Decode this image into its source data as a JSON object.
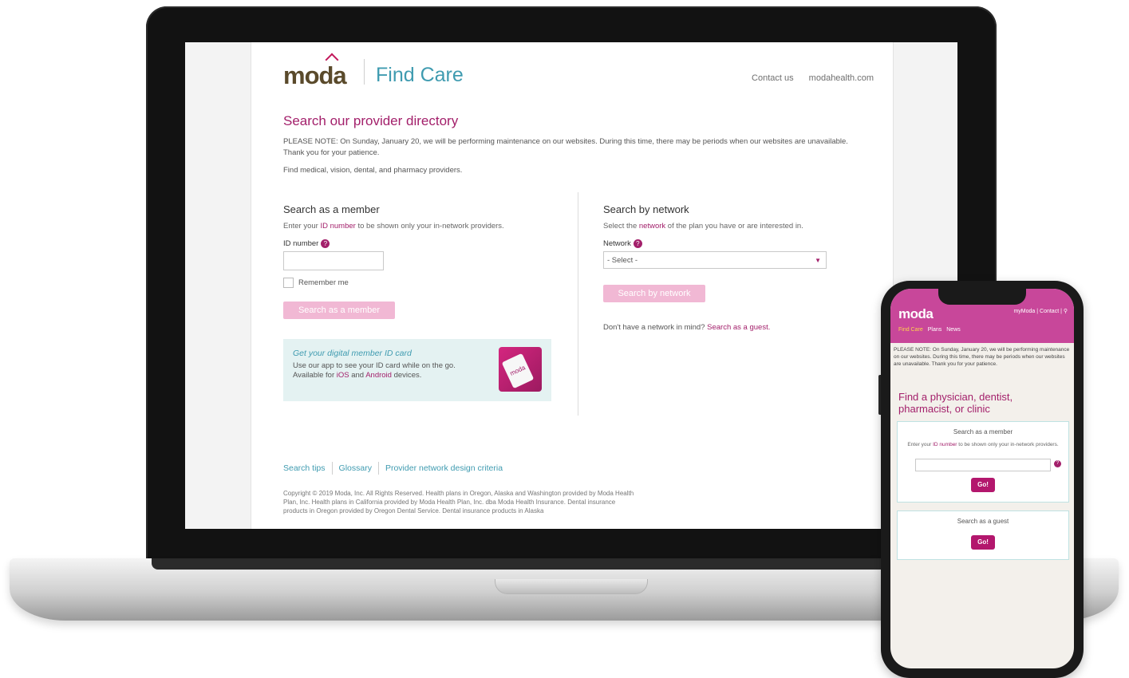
{
  "laptop": {
    "header": {
      "logo_text": "moda",
      "product_name": "Find Care",
      "contact_link": "Contact us",
      "site_link": "modahealth.com"
    },
    "page_title": "Search our provider directory",
    "notice": "PLEASE NOTE: On Sunday, January 20, we will be performing maintenance on our websites. During this time, there may be periods when our websites are unavailable. Thank you for your patience.",
    "subline": "Find medical, vision, dental, and pharmacy providers.",
    "member": {
      "title": "Search as a member",
      "desc_prefix": "Enter your ",
      "desc_link": "ID number",
      "desc_suffix": " to be shown only your in-network providers.",
      "field_label": "ID number",
      "input_value": "",
      "remember_label": "Remember me",
      "button_label": "Search as a member"
    },
    "promo": {
      "title": "Get your digital member ID card",
      "text_1": "Use our app to see your ID card while on the go.",
      "text_2_prefix": "Available for ",
      "ios_link": "iOS",
      "text_2_mid": " and ",
      "android_link": "Android",
      "text_2_suffix": " devices.",
      "card_label": "moda"
    },
    "network": {
      "title": "Search by network",
      "desc_prefix": "Select the ",
      "desc_link": "network",
      "desc_suffix": " of the plan you have or are interested in.",
      "field_label": "Network",
      "select_value": "- Select -",
      "button_label": "Search by network",
      "guest_prefix": "Don't have a network in mind? ",
      "guest_link": "Search as a guest."
    },
    "footer": {
      "links": [
        "Search tips",
        "Glossary",
        "Provider network design criteria"
      ],
      "copyright": "Copyright © 2019 Moda, Inc. All Rights Reserved. Health plans in Oregon, Alaska and Washington provided by Moda Health Plan, Inc. Health plans in California provided by Moda Health Plan, Inc. dba Moda Health Insurance. Dental insurance products in Oregon provided by Oregon Dental Service. Dental insurance products in Alaska"
    }
  },
  "phone": {
    "logo_text": "moda",
    "top_links": [
      "myModa",
      "Contact"
    ],
    "nav": [
      "Find Care",
      "Plans",
      "News"
    ],
    "notice": "PLEASE NOTE: On Sunday, January 20, we will be performing maintenance on our websites. During this time, there may be periods when our websites are unavailable. Thank you for your patience.",
    "heading": "Find a physician, dentist, pharmacist, or clinic",
    "member_box": {
      "title": "Search as a member",
      "desc_prefix": "Enter your ",
      "desc_link": "ID number",
      "desc_suffix": " to be shown only your in-network providers.",
      "button_label": "Go!"
    },
    "guest_box": {
      "title": "Search as a guest",
      "button_label": "Go!"
    }
  },
  "colors": {
    "brand_magenta": "#a3206b",
    "brand_teal": "#3f9bb0",
    "button_disabled_pink": "#f1b8d4",
    "phone_header": "#c8479a"
  }
}
